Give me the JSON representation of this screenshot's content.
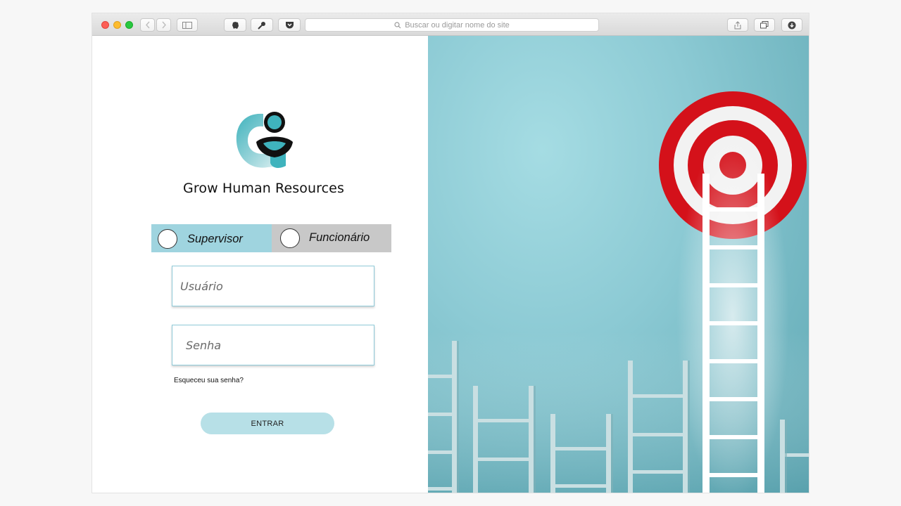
{
  "browser": {
    "address_placeholder": "Buscar ou digitar nome do site",
    "toolbar_icons": [
      "back-icon",
      "forward-icon",
      "sidebar-icon",
      "evernote-icon",
      "password-key-icon",
      "pocket-icon",
      "search-icon",
      "share-icon",
      "tabs-icon",
      "download-icon"
    ]
  },
  "app": {
    "brand_name": "Grow Human Resources",
    "brand_colors": {
      "teal": "#3fb3bd",
      "light_teal": "#9fd4df",
      "dark": "#111111"
    }
  },
  "login": {
    "roles": [
      {
        "label": "Supervisor",
        "selected": false,
        "bg": "#9fd4df"
      },
      {
        "label": "Funcionário",
        "selected": false,
        "bg": "#c8c8c8"
      }
    ],
    "username_placeholder": "Usuário",
    "password_placeholder": "Senha",
    "forgot_password": "Esqueceu sua senha?",
    "submit_label": "ENTRAR",
    "submit_color": "#b7e0e7"
  },
  "hero": {
    "description_icon": "target-ladder-illustration",
    "target_colors": [
      "#d4111a",
      "#ffffff"
    ]
  }
}
